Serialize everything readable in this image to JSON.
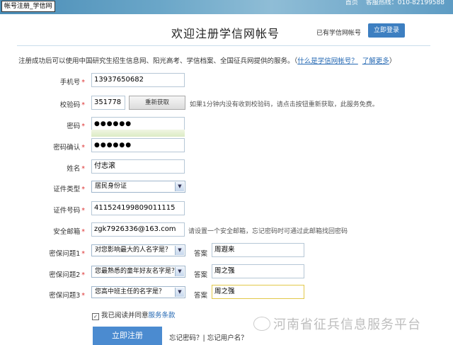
{
  "window": {
    "tab_title": "帐号注册_学信网"
  },
  "header": {
    "links": [
      "首页",
      "客服热线：010-82199588"
    ],
    "title": "欢迎注册学信网帐号",
    "has_account": "已有学信网帐号",
    "login_button": "立即登录"
  },
  "intro": {
    "text": "注册成功后可以使用中国研究生招生信息网、阳光高考、学信档案、全国征兵网提供的服务。",
    "link_what": "什么是学信网帐号？",
    "link_more": "了解更多"
  },
  "form": {
    "phone": {
      "label": "手机号",
      "value": "13937650682"
    },
    "code": {
      "label": "校验码",
      "value": "351778",
      "button": "重新获取",
      "hint": "如果1分钟内没有收到校验码，请点击按钮重新获取，此服务免费。"
    },
    "password": {
      "label": "密码",
      "value": "●●●●●●"
    },
    "password_confirm": {
      "label": "密码确认",
      "value": "●●●●●●"
    },
    "name": {
      "label": "姓名",
      "value": "付志滚"
    },
    "id_type": {
      "label": "证件类型",
      "value": "居民身份证"
    },
    "id_number": {
      "label": "证件号码",
      "value": "411524199809011115"
    },
    "email": {
      "label": "安全邮箱",
      "value": "zgk7926336@163.com",
      "hint": "请设置一个安全邮箱，忘记密码时可通过此邮箱找回密码"
    },
    "questions": [
      {
        "label": "密保问题1",
        "question": "对您影响最大的人名字是？",
        "answer_label": "答案",
        "answer": "周遐来"
      },
      {
        "label": "密保问题2",
        "question": "您最熟悉的童年好友名字是？",
        "answer_label": "答案",
        "answer": "周之强"
      },
      {
        "label": "密保问题3",
        "question": "您高中班主任的名字是？",
        "answer_label": "答案",
        "answer": "周之强"
      }
    ],
    "agree_text": "我已阅读并同意",
    "agree_link": "服务条款",
    "submit": "立即注册",
    "forgot": "忘记密码？| 忘记用户名？"
  },
  "watermark": "河南省征兵信息服务平台"
}
